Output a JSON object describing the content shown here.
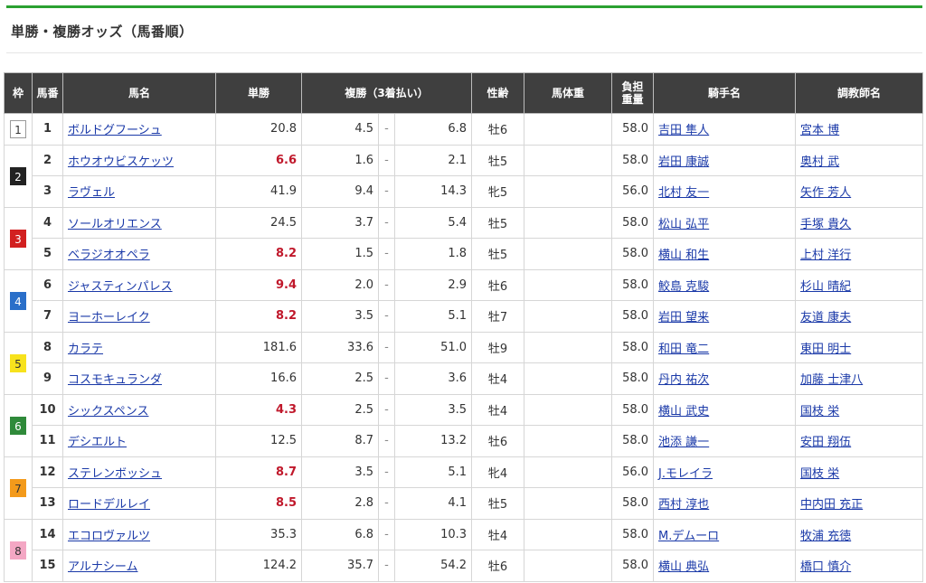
{
  "title": "単勝・複勝オッズ（馬番順）",
  "headers": {
    "waku": "枠",
    "umaban": "馬番",
    "name": "馬名",
    "win": "単勝",
    "place": "複勝（3着払い）",
    "sexage": "性齢",
    "weight": "馬体重",
    "burden_l1": "負担",
    "burden_l2": "重量",
    "jockey": "騎手名",
    "trainer": "調教師名"
  },
  "separator": "-",
  "waku_colors": {
    "1": {
      "bg": "#ffffff",
      "fg": "#333333",
      "border": "#999999"
    },
    "2": {
      "bg": "#222222",
      "fg": "#ffffff",
      "border": "#222222"
    },
    "3": {
      "bg": "#d22020",
      "fg": "#ffffff",
      "border": "#d22020"
    },
    "4": {
      "bg": "#2a6fc9",
      "fg": "#ffffff",
      "border": "#2a6fc9"
    },
    "5": {
      "bg": "#f7e21d",
      "fg": "#333333",
      "border": "#f7e21d"
    },
    "6": {
      "bg": "#2f8a3a",
      "fg": "#ffffff",
      "border": "#2f8a3a"
    },
    "7": {
      "bg": "#f39a1b",
      "fg": "#333333",
      "border": "#f39a1b"
    },
    "8": {
      "bg": "#f4a7c4",
      "fg": "#333333",
      "border": "#f4a7c4"
    }
  },
  "waku_groups": [
    {
      "waku": "1",
      "rows": 1
    },
    {
      "waku": "2",
      "rows": 2
    },
    {
      "waku": "3",
      "rows": 2
    },
    {
      "waku": "4",
      "rows": 2
    },
    {
      "waku": "5",
      "rows": 2
    },
    {
      "waku": "6",
      "rows": 2
    },
    {
      "waku": "7",
      "rows": 2
    },
    {
      "waku": "8",
      "rows": 2
    }
  ],
  "horses": [
    {
      "num": "1",
      "name": "ボルドグフーシュ",
      "win": "20.8",
      "win_highlight": false,
      "place_min": "4.5",
      "place_max": "6.8",
      "sexage": "牡6",
      "weight": "",
      "burden": "58.0",
      "jockey": "吉田 隼人",
      "trainer": "宮本 博"
    },
    {
      "num": "2",
      "name": "ホウオウビスケッツ",
      "win": "6.6",
      "win_highlight": true,
      "place_min": "1.6",
      "place_max": "2.1",
      "sexage": "牡5",
      "weight": "",
      "burden": "58.0",
      "jockey": "岩田 康誠",
      "trainer": "奥村 武"
    },
    {
      "num": "3",
      "name": "ラヴェル",
      "win": "41.9",
      "win_highlight": false,
      "place_min": "9.4",
      "place_max": "14.3",
      "sexage": "牝5",
      "weight": "",
      "burden": "56.0",
      "jockey": "北村 友一",
      "trainer": "矢作 芳人"
    },
    {
      "num": "4",
      "name": "ソールオリエンス",
      "win": "24.5",
      "win_highlight": false,
      "place_min": "3.7",
      "place_max": "5.4",
      "sexage": "牡5",
      "weight": "",
      "burden": "58.0",
      "jockey": "松山 弘平",
      "trainer": "手塚 貴久"
    },
    {
      "num": "5",
      "name": "ベラジオオペラ",
      "win": "8.2",
      "win_highlight": true,
      "place_min": "1.5",
      "place_max": "1.8",
      "sexage": "牡5",
      "weight": "",
      "burden": "58.0",
      "jockey": "横山 和生",
      "trainer": "上村 洋行"
    },
    {
      "num": "6",
      "name": "ジャスティンパレス",
      "win": "9.4",
      "win_highlight": true,
      "place_min": "2.0",
      "place_max": "2.9",
      "sexage": "牡6",
      "weight": "",
      "burden": "58.0",
      "jockey": "鮫島 克駿",
      "trainer": "杉山 晴紀"
    },
    {
      "num": "7",
      "name": "ヨーホーレイク",
      "win": "8.2",
      "win_highlight": true,
      "place_min": "3.5",
      "place_max": "5.1",
      "sexage": "牡7",
      "weight": "",
      "burden": "58.0",
      "jockey": "岩田 望来",
      "trainer": "友道 康夫"
    },
    {
      "num": "8",
      "name": "カラテ",
      "win": "181.6",
      "win_highlight": false,
      "place_min": "33.6",
      "place_max": "51.0",
      "sexage": "牡9",
      "weight": "",
      "burden": "58.0",
      "jockey": "和田 竜二",
      "trainer": "東田 明士"
    },
    {
      "num": "9",
      "name": "コスモキュランダ",
      "win": "16.6",
      "win_highlight": false,
      "place_min": "2.5",
      "place_max": "3.6",
      "sexage": "牡4",
      "weight": "",
      "burden": "58.0",
      "jockey": "丹内 祐次",
      "trainer": "加藤 士津八"
    },
    {
      "num": "10",
      "name": "シックスペンス",
      "win": "4.3",
      "win_highlight": true,
      "place_min": "2.5",
      "place_max": "3.5",
      "sexage": "牡4",
      "weight": "",
      "burden": "58.0",
      "jockey": "横山 武史",
      "trainer": "国枝 栄"
    },
    {
      "num": "11",
      "name": "デシエルト",
      "win": "12.5",
      "win_highlight": false,
      "place_min": "8.7",
      "place_max": "13.2",
      "sexage": "牡6",
      "weight": "",
      "burden": "58.0",
      "jockey": "池添 謙一",
      "trainer": "安田 翔伍"
    },
    {
      "num": "12",
      "name": "ステレンボッシュ",
      "win": "8.7",
      "win_highlight": true,
      "place_min": "3.5",
      "place_max": "5.1",
      "sexage": "牝4",
      "weight": "",
      "burden": "56.0",
      "jockey": "J.モレイラ",
      "trainer": "国枝 栄"
    },
    {
      "num": "13",
      "name": "ロードデルレイ",
      "win": "8.5",
      "win_highlight": true,
      "place_min": "2.8",
      "place_max": "4.1",
      "sexage": "牡5",
      "weight": "",
      "burden": "58.0",
      "jockey": "西村 淳也",
      "trainer": "中内田 充正"
    },
    {
      "num": "14",
      "name": "エコロヴァルツ",
      "win": "35.3",
      "win_highlight": false,
      "place_min": "6.8",
      "place_max": "10.3",
      "sexage": "牡4",
      "weight": "",
      "burden": "58.0",
      "jockey": "M.デムーロ",
      "trainer": "牧浦 充徳"
    },
    {
      "num": "15",
      "name": "アルナシーム",
      "win": "124.2",
      "win_highlight": false,
      "place_min": "35.7",
      "place_max": "54.2",
      "sexage": "牡6",
      "weight": "",
      "burden": "58.0",
      "jockey": "横山 典弘",
      "trainer": "橋口 慎介"
    }
  ]
}
